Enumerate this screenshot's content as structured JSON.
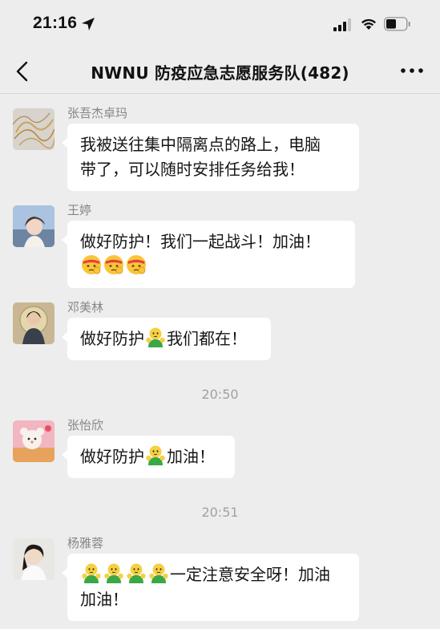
{
  "status_bar": {
    "time": "21:16",
    "location_icon": "location-arrow-icon",
    "signal_icon": "cellular-signal-icon",
    "wifi_icon": "wifi-icon",
    "battery_icon": "battery-icon"
  },
  "header": {
    "back_icon": "chevron-left-icon",
    "title": "NWNU 防疫应急志愿服务队(482)",
    "more_icon": "more-dots-icon"
  },
  "messages": [
    {
      "sender": "张吾杰卓玛",
      "lines": [
        "我被送往集中隔离点的路上，电脑",
        "带了，可以随时安排任务给我！"
      ]
    },
    {
      "sender": "王婷",
      "lines": [
        "做好防护！我们一起战斗！加油！"
      ],
      "emoji_line": [
        "determined-face-emoji",
        "determined-face-emoji",
        "determined-face-emoji"
      ]
    },
    {
      "sender": "邓美林",
      "text_before_emoji": "做好防护",
      "emoji": "fist-pump-emoji",
      "text_after_emoji": "我们都在！"
    }
  ],
  "timestamp_1": "20:50",
  "message_4": {
    "sender": "张怡欣",
    "text_before_emoji": "做好防护",
    "emoji": "fist-pump-emoji",
    "text_after_emoji": "加油！"
  },
  "timestamp_2": "20:51",
  "message_5": {
    "sender": "杨雅蓉",
    "emojis": [
      "fist-pump-emoji",
      "fist-pump-emoji",
      "fist-pump-emoji",
      "fist-pump-emoji"
    ],
    "text_line1": "一定注意安全呀！加油",
    "text_line2": "加油！"
  },
  "colors": {
    "background": "#ededed",
    "bubble": "#ffffff",
    "sender_name": "#868686",
    "timestamp": "#a1a1a1"
  }
}
